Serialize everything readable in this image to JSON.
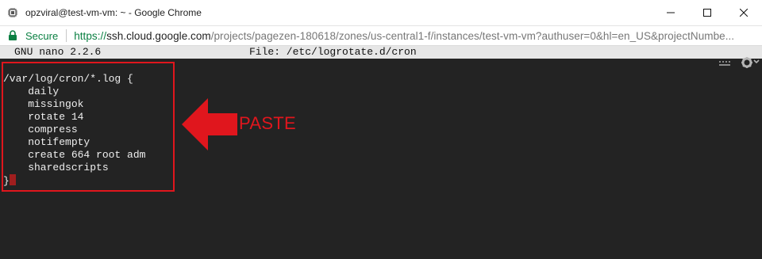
{
  "window": {
    "title": "opzviral@test-vm-vm: ~ - Google Chrome",
    "controls": [
      "minimize",
      "maximize",
      "close"
    ]
  },
  "addressbar": {
    "secure_label": "Secure",
    "url_scheme": "https://",
    "url_host": "ssh.cloud.google.com",
    "url_path": "/projects/pagezen-180618/zones/us-central1-f/instances/test-vm-vm?authuser=0&hl=en_US&projectNumbe..."
  },
  "nano": {
    "version": "GNU nano 2.2.6",
    "file": "File: /etc/logrotate.d/cron"
  },
  "terminal_lines": [
    "/var/log/cron/*.log {",
    "    daily",
    "    missingok",
    "    rotate 14",
    "    compress",
    "    notifempty",
    "    create 664 root adm",
    "    sharedscripts",
    "}"
  ],
  "annotation": {
    "label": "PASTE",
    "color": "#e0161d"
  },
  "colors": {
    "terminal_bg": "#232323",
    "terminal_text": "#efefef",
    "secure_green": "#0b8043",
    "cursor": "#a01e1e"
  }
}
